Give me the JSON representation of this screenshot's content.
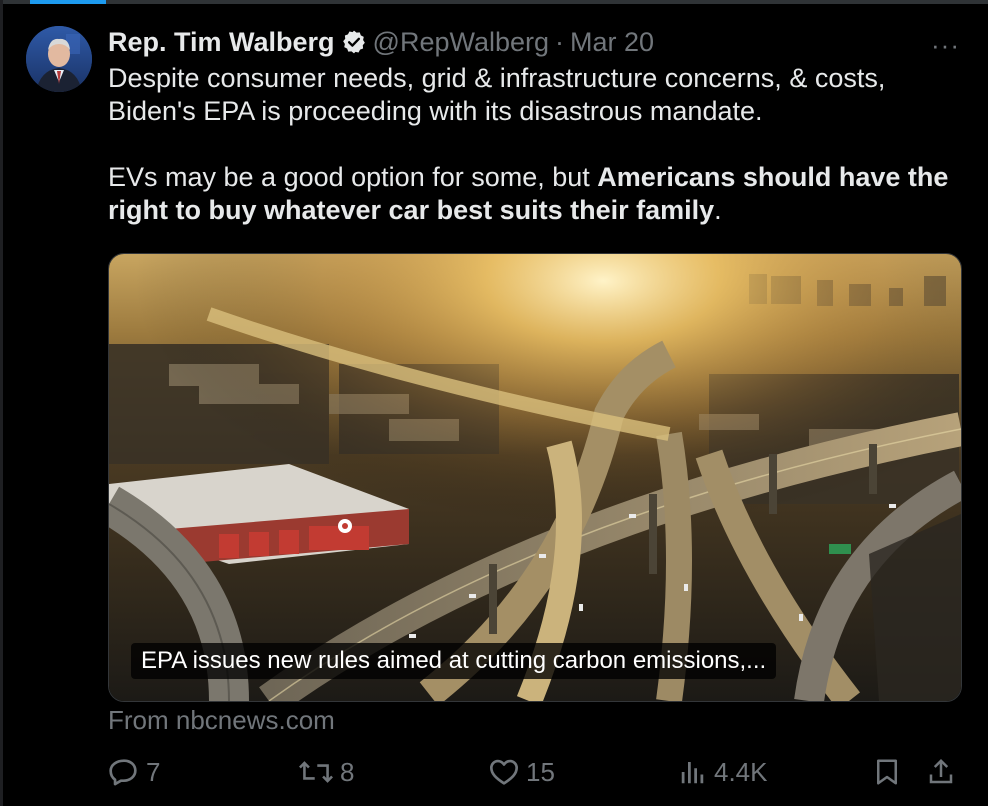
{
  "tweet": {
    "author_name": "Rep. Tim Walberg",
    "handle": "@RepWalberg",
    "separator": "·",
    "date": "Mar 20",
    "more": "···",
    "paragraph1": "Despite consumer needs, grid & infrastructure concerns, & costs, Biden's EPA is proceeding with its disastrous mandate.",
    "paragraph2_normal": "EVs may be a good option for some, but ",
    "paragraph2_bold": "Americans should have the right to buy whatever car best suits their family",
    "paragraph2_end": ".",
    "verified_icon": "verified-badge-icon",
    "accent": "#1d9bf0"
  },
  "card": {
    "caption": "EPA issues new rules aimed at cutting carbon emissions,...",
    "source": "From nbcnews.com"
  },
  "actions": {
    "replies": "7",
    "retweets": "8",
    "likes": "15",
    "views": "4.4K",
    "icons": [
      "reply-icon",
      "retweet-icon",
      "like-icon",
      "views-icon",
      "bookmark-icon",
      "share-icon"
    ]
  }
}
